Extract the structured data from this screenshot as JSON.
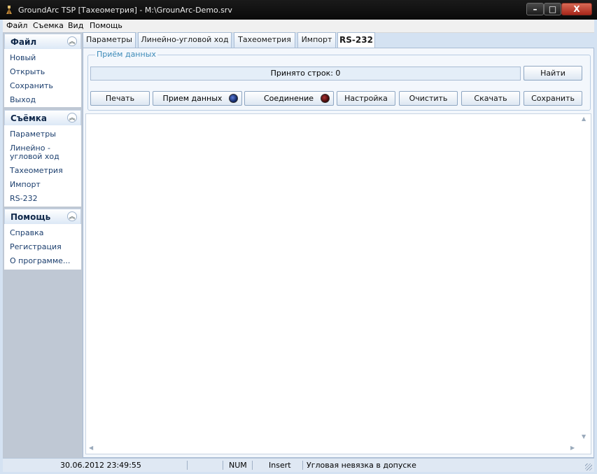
{
  "window": {
    "title": "GroundArc TSP [Тахеометрия] - M:\\GrounArc-Demo.srv",
    "minimize": "–",
    "maximize": "□",
    "close": "X"
  },
  "menu": [
    "Файл",
    "Съемка",
    "Вид",
    "Помощь"
  ],
  "sidebar": {
    "collapse_glyph": "︽",
    "groups": [
      {
        "title": "Файл",
        "items": [
          "Новый",
          "Открыть",
          "Сохранить",
          "Выход"
        ]
      },
      {
        "title": "Съёмка",
        "items": [
          "Параметры",
          "Линейно - угловой ход",
          "Тахеометрия",
          "Импорт",
          "RS-232"
        ]
      },
      {
        "title": "Помощь",
        "items": [
          "Справка",
          "Регистрация",
          "О программе..."
        ]
      }
    ]
  },
  "tabs": [
    {
      "label": "Параметры",
      "active": false
    },
    {
      "label": "Линейно-угловой ход",
      "active": false
    },
    {
      "label": "Тахеометрия",
      "active": false
    },
    {
      "label": "Импорт",
      "active": false
    },
    {
      "label": "RS-232",
      "active": true
    }
  ],
  "rs232": {
    "group_title": "Приём данных",
    "received_lines": "Принято строк: 0",
    "find_button": "Найти",
    "print_button": "Печать",
    "receive_indicator": "Прием данных",
    "connection_indicator": "Соединение",
    "settings_button": "Настройка",
    "clear_button": "Очистить",
    "download_button": "Скачать",
    "save_button": "Сохранить",
    "output_text": ""
  },
  "statusbar": {
    "datetime": "30.06.2012 23:49:55",
    "num": "NUM",
    "insert": "Insert",
    "message": "Угловая невязка в допуске"
  },
  "colors": {
    "title_bar": "#111111",
    "close_button": "#c0392b",
    "sidebar_link": "#1c3f6e",
    "group_title": "#3c8ab8",
    "led_receive": "#1a2f7a",
    "led_connection": "#7a1010"
  }
}
